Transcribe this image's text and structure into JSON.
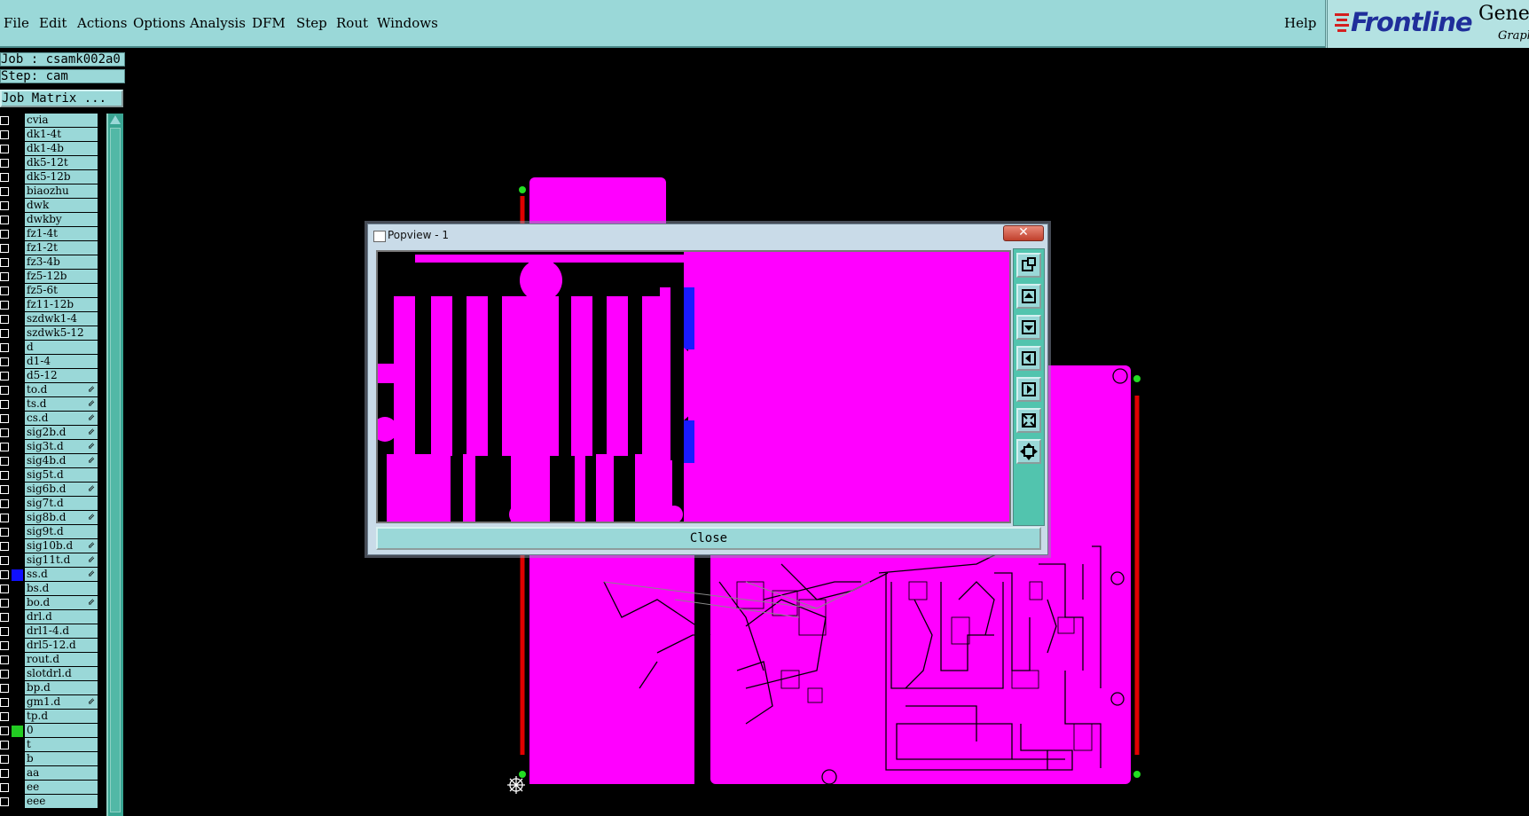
{
  "menu": {
    "items": [
      "File",
      "Edit",
      "Actions",
      "Options",
      "Analysis",
      "DFM",
      "Step",
      "Rout",
      "Windows"
    ],
    "help": "Help"
  },
  "brand": {
    "name": "Frontline",
    "product": "Genesis",
    "subtitle": "Graphic"
  },
  "job": {
    "job_label": "Job : csamk002a0",
    "step_label": "Step: cam",
    "matrix_button": "Job Matrix ..."
  },
  "layers": [
    {
      "name": "cvia",
      "color": "#000000",
      "indicator": ""
    },
    {
      "name": "dk1-4t",
      "color": "#000000",
      "indicator": ""
    },
    {
      "name": "dk1-4b",
      "color": "#000000",
      "indicator": ""
    },
    {
      "name": "dk5-12t",
      "color": "#000000",
      "indicator": ""
    },
    {
      "name": "dk5-12b",
      "color": "#000000",
      "indicator": ""
    },
    {
      "name": "biaozhu",
      "color": "#000000",
      "indicator": ""
    },
    {
      "name": "dwk",
      "color": "#000000",
      "indicator": ""
    },
    {
      "name": "dwkby",
      "color": "#000000",
      "indicator": ""
    },
    {
      "name": "fz1-4t",
      "color": "#000000",
      "indicator": ""
    },
    {
      "name": "fz1-2t",
      "color": "#000000",
      "indicator": ""
    },
    {
      "name": "fz3-4b",
      "color": "#000000",
      "indicator": ""
    },
    {
      "name": "fz5-12b",
      "color": "#000000",
      "indicator": ""
    },
    {
      "name": "fz5-6t",
      "color": "#000000",
      "indicator": ""
    },
    {
      "name": "fz11-12b",
      "color": "#000000",
      "indicator": ""
    },
    {
      "name": "szdwk1-4",
      "color": "#000000",
      "indicator": ""
    },
    {
      "name": "szdwk5-12",
      "color": "#000000",
      "indicator": ""
    },
    {
      "name": "d",
      "color": "#000000",
      "indicator": ""
    },
    {
      "name": "d1-4",
      "color": "#000000",
      "indicator": ""
    },
    {
      "name": "d5-12",
      "color": "#000000",
      "indicator": ""
    },
    {
      "name": "to.d",
      "color": "#000000",
      "indicator": "⇙"
    },
    {
      "name": "ts.d",
      "color": "#000000",
      "indicator": "⇙"
    },
    {
      "name": "cs.d",
      "color": "#000000",
      "indicator": "⇙"
    },
    {
      "name": "sig2b.d",
      "color": "#000000",
      "indicator": "⇙"
    },
    {
      "name": "sig3t.d",
      "color": "#000000",
      "indicator": "⇙"
    },
    {
      "name": "sig4b.d",
      "color": "#000000",
      "indicator": "⇙"
    },
    {
      "name": "sig5t.d",
      "color": "#000000",
      "indicator": ""
    },
    {
      "name": "sig6b.d",
      "color": "#000000",
      "indicator": "⇙"
    },
    {
      "name": "sig7t.d",
      "color": "#000000",
      "indicator": ""
    },
    {
      "name": "sig8b.d",
      "color": "#000000",
      "indicator": "⇙"
    },
    {
      "name": "sig9t.d",
      "color": "#000000",
      "indicator": ""
    },
    {
      "name": "sig10b.d",
      "color": "#000000",
      "indicator": "⇙"
    },
    {
      "name": "sig11t.d",
      "color": "#000000",
      "indicator": "⇙"
    },
    {
      "name": "ss.d",
      "color": "#1010ff",
      "indicator": "⇙"
    },
    {
      "name": "bs.d",
      "color": "#000000",
      "indicator": ""
    },
    {
      "name": "bo.d",
      "color": "#000000",
      "indicator": "⇙"
    },
    {
      "name": "drl.d",
      "color": "#000000",
      "indicator": ""
    },
    {
      "name": "drl1-4.d",
      "color": "#000000",
      "indicator": ""
    },
    {
      "name": "drl5-12.d",
      "color": "#000000",
      "indicator": ""
    },
    {
      "name": "rout.d",
      "color": "#000000",
      "indicator": ""
    },
    {
      "name": "slotdrl.d",
      "color": "#000000",
      "indicator": ""
    },
    {
      "name": "bp.d",
      "color": "#000000",
      "indicator": ""
    },
    {
      "name": "gm1.d",
      "color": "#000000",
      "indicator": "⇙"
    },
    {
      "name": "tp.d",
      "color": "#000000",
      "indicator": ""
    },
    {
      "name": "0",
      "color": "#22cc22",
      "indicator": ""
    },
    {
      "name": "t",
      "color": "#000000",
      "indicator": ""
    },
    {
      "name": "b",
      "color": "#000000",
      "indicator": ""
    },
    {
      "name": "aa",
      "color": "#000000",
      "indicator": ""
    },
    {
      "name": "ee",
      "color": "#000000",
      "indicator": ""
    },
    {
      "name": "eee",
      "color": "#000000",
      "indicator": ""
    }
  ],
  "popview": {
    "title": "Popview - 1",
    "close_x": "✕",
    "close_button": "Close",
    "tools": [
      "zoom-window-icon",
      "pan-up-icon",
      "pan-down-icon",
      "pan-left-icon",
      "pan-right-icon",
      "zoom-fit-icon",
      "zoom-home-icon"
    ]
  },
  "colors": {
    "board": "#ff00ff",
    "panel_bg": "#9ad8d8",
    "scrollbar": "#3aa593",
    "marker_red": "#e00000",
    "marker_green": "#22dd22"
  }
}
